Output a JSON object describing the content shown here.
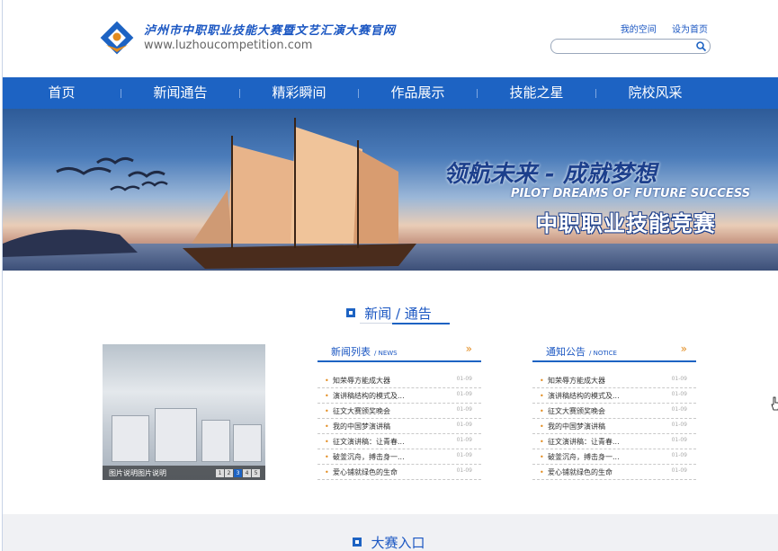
{
  "header": {
    "title": "泸州市中职职业技能大赛暨文艺汇演大赛官网",
    "url": "www.luzhoucompetition.com",
    "links": [
      "我的空间",
      "设为首页"
    ],
    "search_placeholder": ""
  },
  "nav": {
    "items": [
      "首页",
      "新闻通告",
      "精彩瞬间",
      "作品展示",
      "技能之星",
      "院校风采"
    ]
  },
  "banner": {
    "slogan_cn": "领航未来 - 成就梦想",
    "slogan_en": "PILOT DREAMS OF FUTURE SUCCESS",
    "slogan_title": "中职职业技能竞赛"
  },
  "news_section": {
    "title": "新闻 / 通告",
    "photo_caption": "图片说明图片说明",
    "photo_pages": [
      "1",
      "2",
      "3",
      "4",
      "5"
    ],
    "photo_active_page": 3,
    "news_list": {
      "title": "新闻列表",
      "subtitle": "/ NEWS",
      "more": "»",
      "items": [
        {
          "text": "知荣辱方能成大器",
          "date": "01-09"
        },
        {
          "text": "演讲稿结构的模式及...",
          "date": "01-09"
        },
        {
          "text": "征文大赛颁奖晚会",
          "date": "01-09"
        },
        {
          "text": "我的中国梦演讲稿",
          "date": "01-09"
        },
        {
          "text": "征文演讲稿：让青春...",
          "date": "01-09"
        },
        {
          "text": "破釜沉舟，搏击身一...",
          "date": "01-09"
        },
        {
          "text": "爱心铺就绿色的生命",
          "date": "01-09"
        }
      ]
    },
    "notice_list": {
      "title": "通知公告",
      "subtitle": "/ NOTICE",
      "more": "»",
      "items": [
        {
          "text": "知荣辱方能成大器",
          "date": "01-09"
        },
        {
          "text": "演讲稿结构的模式及...",
          "date": "01-09"
        },
        {
          "text": "征文大赛颁奖晚会",
          "date": "01-09"
        },
        {
          "text": "我的中国梦演讲稿",
          "date": "01-09"
        },
        {
          "text": "征文演讲稿：让青春...",
          "date": "01-09"
        },
        {
          "text": "破釜沉舟，搏击身一...",
          "date": "01-09"
        },
        {
          "text": "爱心铺就绿色的生命",
          "date": "01-09"
        }
      ]
    }
  },
  "entry_section": {
    "title": "大赛入口"
  },
  "colors": {
    "primary": "#1d63c3",
    "accent": "#e28b1e"
  }
}
